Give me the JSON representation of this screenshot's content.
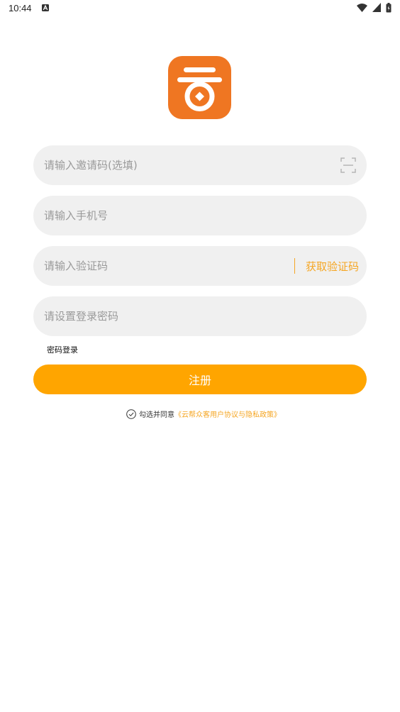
{
  "status_bar": {
    "time": "10:44"
  },
  "app": {
    "logo_character": "云",
    "logo_color": "#ef7622"
  },
  "form": {
    "invite_placeholder": "请输入邀请码(选填)",
    "phone_placeholder": "请输入手机号",
    "code_placeholder": "请输入验证码",
    "get_code_label": "获取验证码",
    "password_placeholder": "请设置登录密码",
    "password_login_link": "密码登录",
    "register_label": "注册"
  },
  "agreement": {
    "prefix": "勾选并同意",
    "link": "《云帮众客用户协议与隐私政策》",
    "checked": false
  },
  "colors": {
    "accent": "#ffa500",
    "link": "#f5a623",
    "field_bg": "#f0f0f0"
  },
  "icons": [
    "wifi-icon",
    "signal-icon",
    "battery-icon",
    "scan-icon",
    "check-circle-icon",
    "notification-a-icon"
  ]
}
